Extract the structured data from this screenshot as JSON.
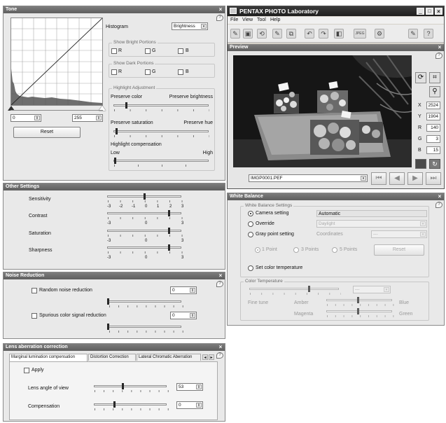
{
  "tone": {
    "title": "Tone",
    "histogram_label": "Histogram",
    "histogram_select": "Brightness",
    "show_bright_title": "Show Bright Portions",
    "show_dark_title": "Show Dark Portions",
    "ch_r": "R",
    "ch_g": "G",
    "ch_b": "B",
    "highlight_title": "Highlight Adjustment",
    "preserve_color": "Preserve color",
    "preserve_brightness": "Preserve brightness",
    "preserve_saturation": "Preserve saturation",
    "preserve_hue": "Preserve hue",
    "highlight_comp": "Highlight compensation",
    "low": "Low",
    "high": "High",
    "input_low": "0",
    "input_high": "255",
    "reset": "Reset"
  },
  "other": {
    "title": "Other Settings",
    "sensitivity": "Sensitivity",
    "contrast": "Contrast",
    "saturation": "Saturation",
    "sharpness": "Sharpness",
    "scale7": [
      "-3",
      "-2",
      "-1",
      "0",
      "1",
      "2",
      "3"
    ],
    "scale3": [
      "-3",
      "0",
      "3"
    ]
  },
  "noise": {
    "title": "Noise Reduction",
    "random": "Random noise reduction",
    "random_value": "0",
    "spurious": "Spurious color signal reduction",
    "spurious_value": "0"
  },
  "lens": {
    "title": "Lens aberration correction",
    "tabs": [
      "Marginal lumination compensation",
      "Distortion Correction",
      "Lateral Chromatic Aberration"
    ],
    "apply": "Apply",
    "angle": "Lens angle of view",
    "angle_value": "53",
    "comp": "Compensation",
    "comp_value": "0"
  },
  "app": {
    "title": "PENTAX PHOTO Laboratory",
    "menu": [
      "File",
      "View",
      "Tool",
      "Help"
    ]
  },
  "preview": {
    "title": "Preview",
    "filename": "IMGP0001.PEF",
    "readout": [
      {
        "label": "X",
        "value": "2524"
      },
      {
        "label": "Y",
        "value": "1904"
      },
      {
        "label": "R",
        "value": "140"
      },
      {
        "label": "G",
        "value": "3"
      },
      {
        "label": "B",
        "value": "15"
      }
    ]
  },
  "wb": {
    "title": "White Balance",
    "settings_title": "White Balance Settings",
    "camera_setting": "Camera setting",
    "camera_value": "Automatic",
    "override": "Override",
    "override_value": "Daylight",
    "gray_point": "Gray point setting",
    "coordinates": "Coordinates",
    "coord_value": "---",
    "point1": "1 Point",
    "point3": "3 Points",
    "point5": "5 Points",
    "reset": "Reset",
    "set_color_temp": "Set color temperature",
    "color_temp_title": "Color Temperature",
    "temp_value": "---",
    "fine_tune": "Fine tune",
    "amber": "Amber",
    "blue": "Blue",
    "magenta": "Magenta",
    "green": "Green"
  },
  "colors": {
    "title_bar": "#0a246a",
    "panel_title": "#666666",
    "panel_bg": "#e9e9e9"
  }
}
